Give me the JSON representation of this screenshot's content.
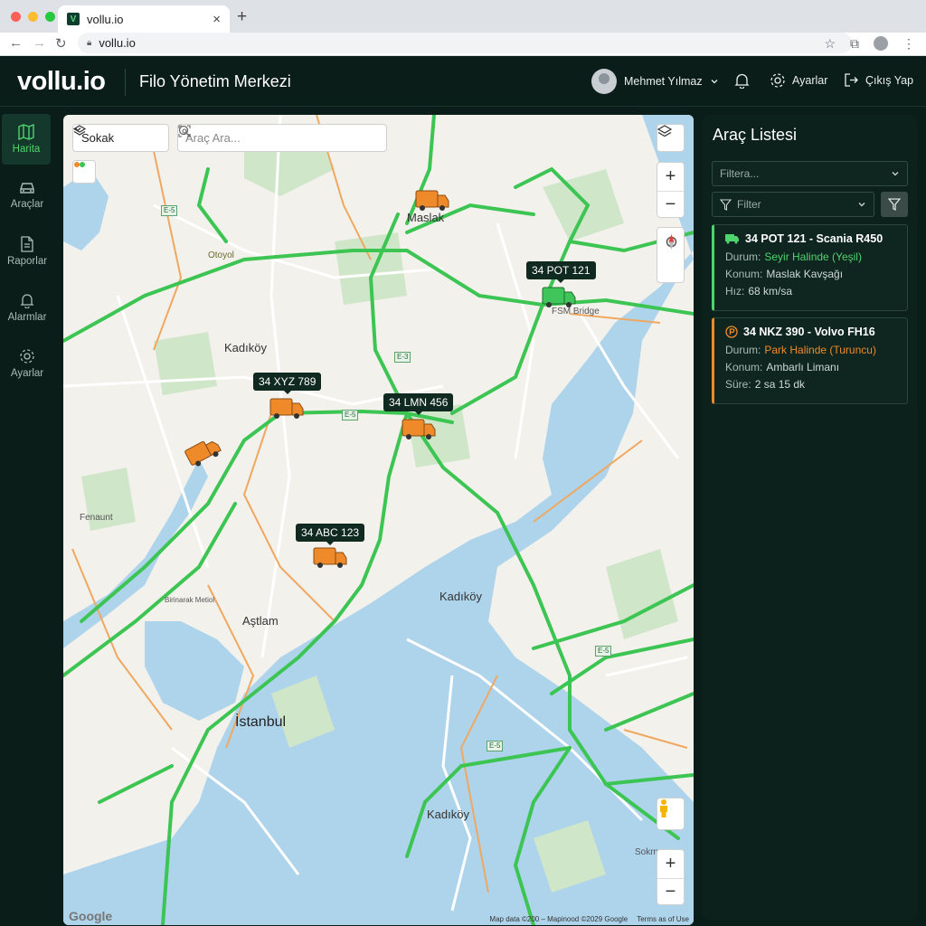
{
  "browser": {
    "tab_title": "vollu.io",
    "favicon_letter": "V",
    "url": "vollu.io"
  },
  "header": {
    "logo": "vollu.io",
    "title": "Filo Yönetim Merkezi",
    "user_name": "Mehmet Yılmaz",
    "settings_label": "Ayarlar",
    "logout_label": "Çıkış Yap"
  },
  "sidebar": {
    "items": [
      {
        "label": "Harita",
        "icon": "map-icon",
        "active": true
      },
      {
        "label": "Araçlar",
        "icon": "car-icon",
        "active": false
      },
      {
        "label": "Raporlar",
        "icon": "document-icon",
        "active": false
      },
      {
        "label": "Alarmlar",
        "icon": "bell-icon",
        "active": false
      },
      {
        "label": "Ayarlar",
        "icon": "gear-icon",
        "active": false
      }
    ]
  },
  "map": {
    "map_type": "Sokak",
    "search_placeholder": "Araç Ara...",
    "vehicle_labels": {
      "pot": "34 POT 121",
      "xyz": "34 XYZ 789",
      "lmn": "34 LMN 456",
      "abc": "34 ABC 123"
    },
    "place_labels": {
      "maslak": "Maslak",
      "bridge": "FSM Bridge",
      "kadikoy1": "Kadıköy",
      "kadikoy2": "Kadıköy",
      "kadikoy3": "Kadıköy",
      "istanbul": "İstanbul",
      "atlam": "Aştlam",
      "fenaunt": "Fenaunt",
      "otoyol": "Otoyol",
      "birinarak": "Birinarak Metiol",
      "sokrn": "Sokrn"
    },
    "route_shields": [
      "E-5",
      "E-3",
      "E-5",
      "E-5",
      "E-5"
    ],
    "google": "Google",
    "attribution": "Map data ©200 – Mapinood ©2029 Google",
    "terms": "Terms as of Use",
    "colors": {
      "traffic": "#3cc553",
      "vehicle": "#ef8a2b",
      "moving": "#3fc55a",
      "water": "#aed4ec"
    }
  },
  "panel": {
    "title": "Araç Listesi",
    "filter_placeholder": "Filtera...",
    "filter_label": "Filter",
    "vehicles": [
      {
        "title": "34 POT 121 - Scania R450",
        "status_label": "Durum:",
        "status": "Seyir Halinde (Yeşil)",
        "location_label": "Konum:",
        "location": "Maslak Kavşağı",
        "extra_label": "Hız:",
        "extra": "68 km/sa",
        "color": "#4fd36d"
      },
      {
        "title": "34 NKZ 390 - Volvo FH16",
        "status_label": "Durum:",
        "status": "Park Halinde (Turuncu)",
        "location_label": "Konum:",
        "location": "Ambarlı Limanı",
        "extra_label": "Süre:",
        "extra": "2 sa 15 dk",
        "color": "#ef8a2b"
      }
    ]
  }
}
